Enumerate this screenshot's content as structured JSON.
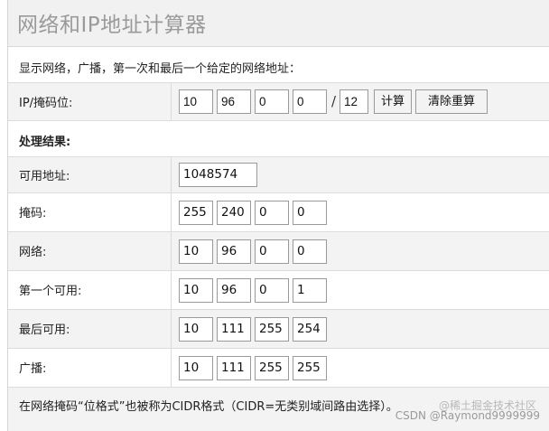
{
  "title": "网络和IP地址计算器",
  "description": "显示网络，广播，第一次和最后一个给定的网络地址：",
  "input_row": {
    "label": "IP/掩码位:",
    "octets": [
      "10",
      "96",
      "0",
      "0"
    ],
    "slash": "/",
    "mask_bits": "12",
    "calc_button": "计算",
    "clear_button": "清除重算"
  },
  "results_header": "处理结果:",
  "usable_row": {
    "label": "可用地址:",
    "value": "1048574"
  },
  "mask_row": {
    "label": "掩码:",
    "octets": [
      "255",
      "240",
      "0",
      "0"
    ]
  },
  "network_row": {
    "label": "网络:",
    "octets": [
      "10",
      "96",
      "0",
      "0"
    ]
  },
  "first_row": {
    "label": "第一个可用:",
    "octets": [
      "10",
      "96",
      "0",
      "1"
    ]
  },
  "last_row": {
    "label": "最后可用:",
    "octets": [
      "10",
      "111",
      "255",
      "254"
    ]
  },
  "broadcast_row": {
    "label": "广播:",
    "octets": [
      "10",
      "111",
      "255",
      "255"
    ]
  },
  "footer_note": "在网络掩码“位格式”也被称为CIDR格式（CIDR=无类别域间路由选择）。",
  "watermark": "CSDN @Raymond9999999",
  "watermark_faint": "@稀土掘金技术社区"
}
